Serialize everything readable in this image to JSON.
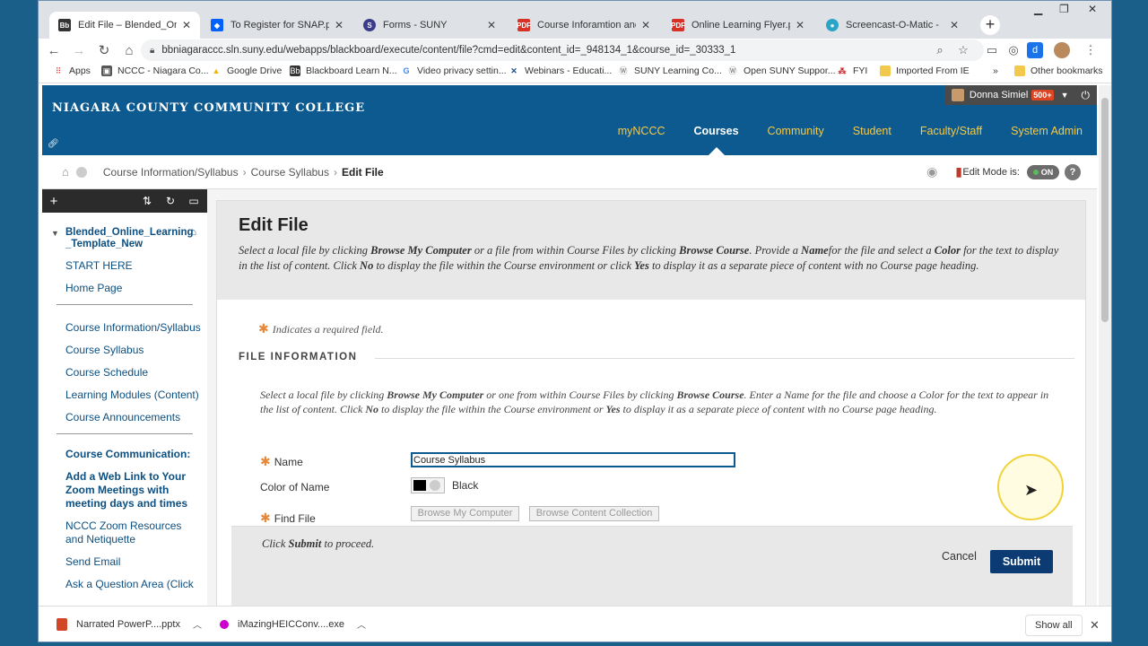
{
  "tabs": [
    {
      "label": "Edit File – Blended_Online_L",
      "icon": "blackboard-icon",
      "color": "#333333",
      "active": true
    },
    {
      "label": "To Register for SNAP.pdf",
      "icon": "dropbox-icon",
      "color": "#0061fe"
    },
    {
      "label": "Forms - SUNY",
      "icon": "suny-icon",
      "color": "#3c3c8a"
    },
    {
      "label": "Course Inforamtion and Syll",
      "icon": "pdf-icon",
      "color": "#d93025"
    },
    {
      "label": "Online Learning Flyer.pdf - C",
      "icon": "pdf-icon",
      "color": "#d93025"
    },
    {
      "label": "Screencast-O-Matic -",
      "icon": "screencast-icon",
      "color": "#2aa4c7"
    }
  ],
  "url": "bbniagaraccc.sln.suny.edu/webapps/blackboard/execute/content/file?cmd=edit&content_id=_948134_1&course_id=_30333_1",
  "bookmarks": [
    {
      "label": "Apps"
    },
    {
      "label": "NCCC - Niagara Co..."
    },
    {
      "label": "Google Drive"
    },
    {
      "label": "Blackboard Learn N..."
    },
    {
      "label": "Video privacy settin..."
    },
    {
      "label": "Webinars - Educati..."
    },
    {
      "label": "SUNY Learning Co..."
    },
    {
      "label": "Open SUNY Suppor..."
    },
    {
      "label": "FYI"
    },
    {
      "label": "Imported From IE"
    },
    {
      "label": "»"
    },
    {
      "label": "Other bookmarks"
    }
  ],
  "header": {
    "college": "NIAGARA COUNTY COMMUNITY COLLEGE",
    "user": "Donna Simiel",
    "user_badge": "500+",
    "nav": [
      "myNCCC",
      "Courses",
      "Community",
      "Student",
      "Faculty/Staff",
      "System Admin"
    ],
    "active_nav": "Courses"
  },
  "breadcrumb": [
    "Course Information/Syllabus",
    "Course Syllabus",
    "Edit File"
  ],
  "edit_mode": {
    "label": "Edit Mode is:",
    "state": "ON"
  },
  "sidebar": {
    "course": "Blended_Online_Learning _Template_New",
    "group1": [
      "START HERE",
      "Home Page"
    ],
    "group2": [
      "Course Information/Syllabus",
      "Course Syllabus",
      "Course Schedule",
      "Learning Modules (Content)",
      "Course Announcements"
    ],
    "heading": "Course Communication:",
    "bold_item": "Add a Web Link to Your Zoom Meetings with meeting days and times",
    "group3": [
      "NCCC Zoom Resources and Netiquette",
      "Send Email",
      "Ask a Question Area (Click"
    ]
  },
  "main": {
    "title": "Edit File",
    "required_note": "Indicates a required field.",
    "section_title": "FILE INFORMATION",
    "name_label": "Name",
    "name_value": "Course Syllabus",
    "color_label": "Color of Name",
    "color_value": "Black",
    "find_label": "Find File",
    "browse_my_computer": "Browse My Computer",
    "browse_content": "Browse Content Collection",
    "cancel": "Cancel",
    "submit": "Submit"
  },
  "downloads": [
    {
      "label": "Narrated PowerP....pptx"
    },
    {
      "label": "iMazingHEICConv....exe"
    }
  ],
  "show_all": "Show all"
}
